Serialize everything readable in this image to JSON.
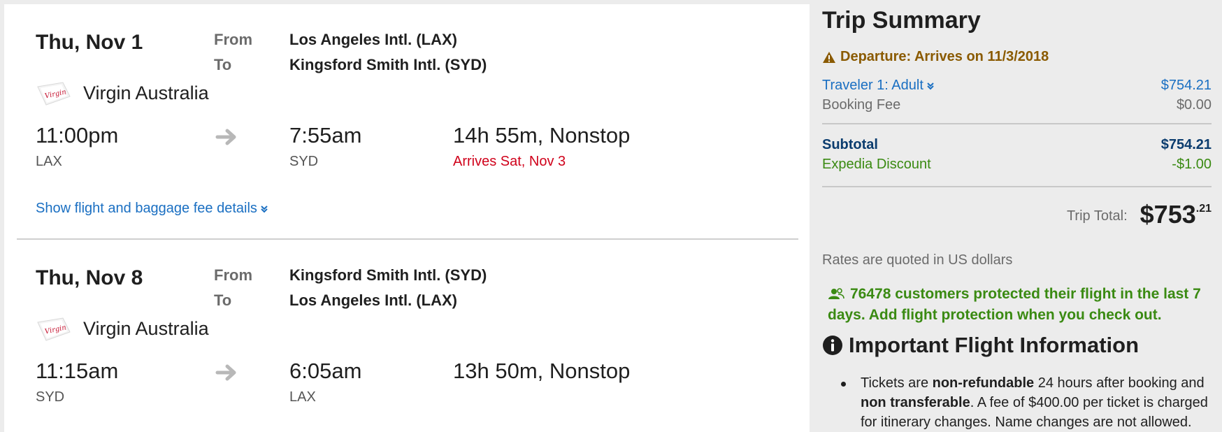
{
  "flights": [
    {
      "date": "Thu, Nov 1",
      "from_label": "From",
      "to_label": "To",
      "from_airport": "Los Angeles Intl. (LAX)",
      "to_airport": "Kingsford Smith Intl. (SYD)",
      "airline_logo": "virgin-logo-icon",
      "airline": "Virgin Australia",
      "depart_time": "11:00pm",
      "depart_code": "LAX",
      "arrive_time": "7:55am",
      "arrive_code": "SYD",
      "duration": "14h 55m, Nonstop",
      "arrives_note": "Arrives Sat, Nov 3",
      "details_link": "Show flight and baggage fee details"
    },
    {
      "date": "Thu, Nov 8",
      "from_label": "From",
      "to_label": "To",
      "from_airport": "Kingsford Smith Intl. (SYD)",
      "to_airport": "Los Angeles Intl. (LAX)",
      "airline_logo": "virgin-logo-icon",
      "airline": "Virgin Australia",
      "depart_time": "11:15am",
      "depart_code": "SYD",
      "arrive_time": "6:05am",
      "arrive_code": "LAX",
      "duration": "13h 50m, Nonstop"
    }
  ],
  "summary": {
    "title": "Trip Summary",
    "warning": "Departure: Arrives on 11/3/2018",
    "traveler_label": "Traveler 1: Adult",
    "traveler_price": "$754.21",
    "fee_label": "Booking Fee",
    "fee_value": "$0.00",
    "subtotal_label": "Subtotal",
    "subtotal_value": "$754.21",
    "discount_label": "Expedia Discount",
    "discount_value": "-$1.00",
    "total_label": "Trip Total:",
    "total_dollars": "$753",
    "total_cents": ".21",
    "rates_note": "Rates are quoted in US dollars",
    "protect_note": "76478 customers protected their flight in the last 7 days. Add flight protection when you check out.",
    "info_title": "Important Flight Information",
    "info_t1": "Tickets are ",
    "info_b1": "non-refundable",
    "info_t2": " 24 hours after booking and ",
    "info_b2": "non transferable",
    "info_t3": ". A fee of $400.00 per ticket is charged for itinerary changes. Name changes are not allowed."
  },
  "colors": {
    "link": "#1a6fc2",
    "alert_red": "#d0021b",
    "warning_brown": "#8a5a00",
    "discount_green": "#3a8a12",
    "subtotal_navy": "#0b3c6e",
    "panel_bg": "#ececec"
  }
}
